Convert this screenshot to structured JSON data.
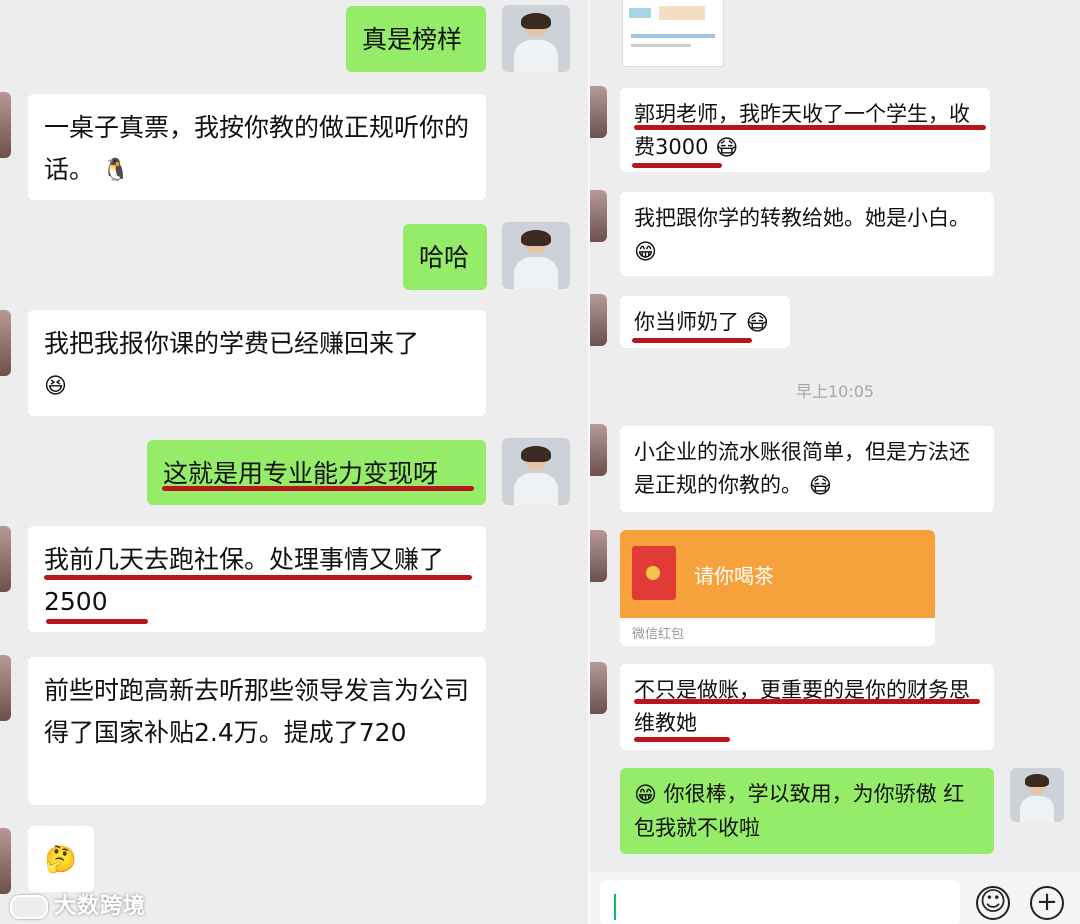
{
  "left": {
    "messages": [
      {
        "side": "me",
        "text": "真是榜样"
      },
      {
        "side": "peer",
        "text": "一桌子真票，我按你教的做正规听你的话。",
        "emoji": "🐧"
      },
      {
        "side": "me",
        "text": "哈哈"
      },
      {
        "side": "peer",
        "text": "我把我报你课的学费已经赚回来了",
        "emoji": "😆"
      },
      {
        "side": "me",
        "text": "这就是用专业能力变现呀"
      },
      {
        "side": "peer",
        "text": "我前几天去跑社保。处理事情又赚了2500"
      },
      {
        "side": "peer",
        "text": "前些时跑高新去听那些领导发言为公司得了国家补贴2.4万。提成了720"
      },
      {
        "side": "peer",
        "text": "",
        "emoji": "🤔"
      }
    ]
  },
  "right": {
    "messages": [
      {
        "side": "peer",
        "text": "郭玥老师，我昨天收了一个学生，收费3000",
        "emoji": "😷"
      },
      {
        "side": "peer",
        "text": "我把跟你学的转教给她。她是小白。",
        "emoji": "😁"
      },
      {
        "side": "peer",
        "text": "你当师奶了",
        "emoji": "😷"
      },
      {
        "side": "peer",
        "text": "小企业的流水账很简单，但是方法还是正规的你教的。",
        "emoji": "😷"
      },
      {
        "side": "peer",
        "text": "不只是做账，更重要的是你的财务思维教她"
      },
      {
        "side": "me",
        "text": "你很棒，学以致用，为你骄傲 红包我就不收啦",
        "emoji": "😁"
      }
    ],
    "timestamp": "早上10:05",
    "red_packet": {
      "title": "请你喝茶",
      "footer": "微信红包"
    }
  },
  "watermark": "大数跨境",
  "colors": {
    "self_bubble": "#95ec69",
    "peer_bubble": "#ffffff",
    "underline": "#b8161b",
    "background": "#ededed"
  }
}
